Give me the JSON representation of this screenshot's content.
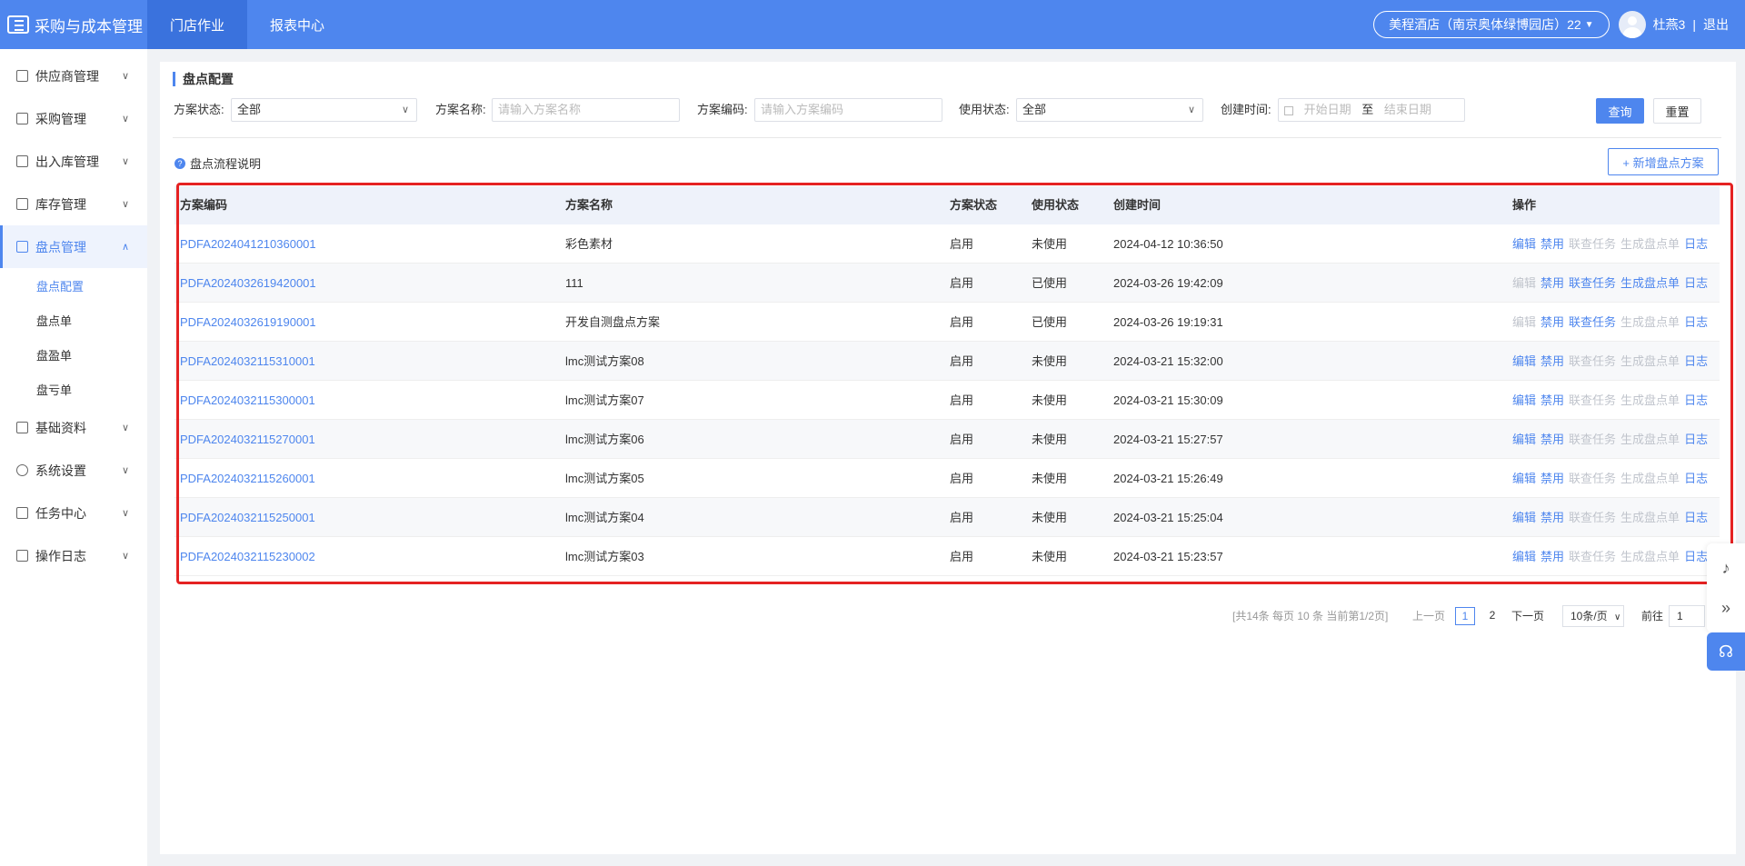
{
  "app": {
    "title": "采购与成本管理"
  },
  "topnav": [
    {
      "label": "门店作业",
      "active": true
    },
    {
      "label": "报表中心",
      "active": false
    }
  ],
  "header": {
    "store": "美程酒店（南京奥体绿博园店）22",
    "user": "杜燕3",
    "sep": "|",
    "logout": "退出"
  },
  "sidebar": {
    "items": [
      {
        "label": "供应商管理",
        "icon": "supplier-icon"
      },
      {
        "label": "采购管理",
        "icon": "purchase-icon"
      },
      {
        "label": "出入库管理",
        "icon": "inout-icon"
      },
      {
        "label": "库存管理",
        "icon": "inventory-icon"
      },
      {
        "label": "盘点管理",
        "icon": "stocktake-icon",
        "active": true
      }
    ],
    "subitems": [
      {
        "label": "盘点配置",
        "active": true
      },
      {
        "label": "盘点单"
      },
      {
        "label": "盘盈单"
      },
      {
        "label": "盘亏单"
      }
    ],
    "items_after": [
      {
        "label": "基础资料",
        "icon": "basic-data-icon"
      },
      {
        "label": "系统设置",
        "icon": "settings-icon"
      },
      {
        "label": "任务中心",
        "icon": "task-icon"
      },
      {
        "label": "操作日志",
        "icon": "log-icon"
      }
    ]
  },
  "page": {
    "title": "盘点配置"
  },
  "filters": {
    "status_label": "方案状态:",
    "status_value": "全部",
    "name_label": "方案名称:",
    "name_placeholder": "请输入方案名称",
    "code_label": "方案编码:",
    "code_placeholder": "请输入方案编码",
    "use_label": "使用状态:",
    "use_value": "全部",
    "time_label": "创建时间:",
    "start_placeholder": "开始日期",
    "to": "至",
    "end_placeholder": "结束日期",
    "query": "查询",
    "reset": "重置"
  },
  "help": "盘点流程说明",
  "add_button": "+ 新增盘点方案",
  "table": {
    "headers": [
      "方案编码",
      "方案名称",
      "方案状态",
      "使用状态",
      "创建时间",
      "操作"
    ],
    "rows": [
      {
        "code": "PDFA2024041210360001",
        "name": "彩色素材",
        "status": "启用",
        "use": "未使用",
        "time": "2024-04-12 10:36:50",
        "ops": [
          true,
          true,
          false,
          false,
          true
        ]
      },
      {
        "code": "PDFA2024032619420001",
        "name": "111",
        "status": "启用",
        "use": "已使用",
        "time": "2024-03-26 19:42:09",
        "ops": [
          false,
          true,
          true,
          true,
          true
        ]
      },
      {
        "code": "PDFA2024032619190001",
        "name": "开发自测盘点方案",
        "status": "启用",
        "use": "已使用",
        "time": "2024-03-26 19:19:31",
        "ops": [
          false,
          true,
          true,
          false,
          true
        ]
      },
      {
        "code": "PDFA2024032115310001",
        "name": "lmc测试方案08",
        "status": "启用",
        "use": "未使用",
        "time": "2024-03-21 15:32:00",
        "ops": [
          true,
          true,
          false,
          false,
          true
        ]
      },
      {
        "code": "PDFA2024032115300001",
        "name": "lmc测试方案07",
        "status": "启用",
        "use": "未使用",
        "time": "2024-03-21 15:30:09",
        "ops": [
          true,
          true,
          false,
          false,
          true
        ]
      },
      {
        "code": "PDFA2024032115270001",
        "name": "lmc测试方案06",
        "status": "启用",
        "use": "未使用",
        "time": "2024-03-21 15:27:57",
        "ops": [
          true,
          true,
          false,
          false,
          true
        ]
      },
      {
        "code": "PDFA2024032115260001",
        "name": "lmc测试方案05",
        "status": "启用",
        "use": "未使用",
        "time": "2024-03-21 15:26:49",
        "ops": [
          true,
          true,
          false,
          false,
          true
        ]
      },
      {
        "code": "PDFA2024032115250001",
        "name": "lmc测试方案04",
        "status": "启用",
        "use": "未使用",
        "time": "2024-03-21 15:25:04",
        "ops": [
          true,
          true,
          false,
          false,
          true
        ]
      },
      {
        "code": "PDFA2024032115230002",
        "name": "lmc测试方案03",
        "status": "启用",
        "use": "未使用",
        "time": "2024-03-21 15:23:57",
        "ops": [
          true,
          true,
          false,
          false,
          true
        ]
      }
    ],
    "op_labels": [
      "编辑",
      "禁用",
      "联查任务",
      "生成盘点单",
      "日志"
    ]
  },
  "pagination": {
    "summary": "[共14条 每页 10 条 当前第1/2页]",
    "prev": "上一页",
    "pages": [
      "1",
      "2"
    ],
    "next": "下一页",
    "page_size": "10条/页",
    "goto_label": "前往",
    "goto_value": "1"
  }
}
